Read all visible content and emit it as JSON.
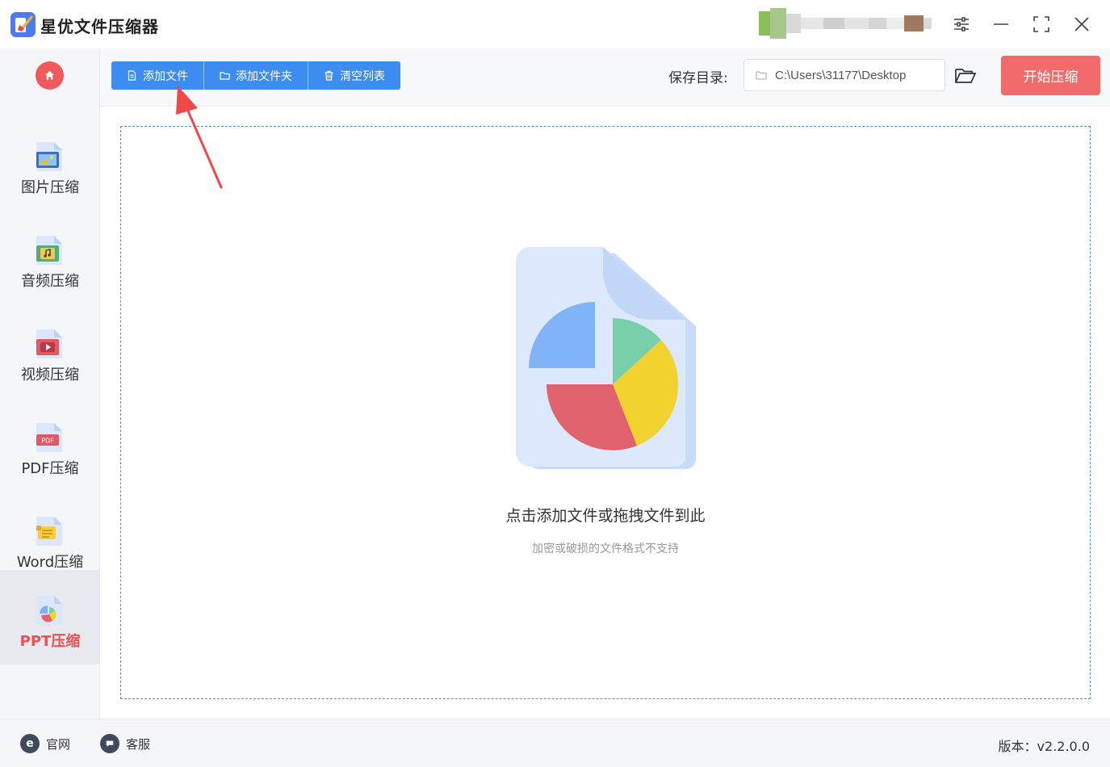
{
  "app": {
    "title": "星优文件压缩器"
  },
  "window_controls": {
    "icons": [
      "sliders-icon",
      "minimize-icon",
      "maximize-icon",
      "close-icon"
    ]
  },
  "sidebar": {
    "items": [
      {
        "label": "图片压缩",
        "icon": "image-file-icon"
      },
      {
        "label": "音频压缩",
        "icon": "audio-file-icon"
      },
      {
        "label": "视频压缩",
        "icon": "video-file-icon"
      },
      {
        "label": "PDF压缩",
        "icon": "pdf-file-icon"
      },
      {
        "label": "Word压缩",
        "icon": "word-file-icon"
      },
      {
        "label": "PPT压缩",
        "icon": "ppt-file-icon"
      }
    ],
    "active_index": 5,
    "accent_color": "#ee5050"
  },
  "toolbar": {
    "add_file_label": "添加文件",
    "add_folder_label": "添加文件夹",
    "clear_list_label": "清空列表",
    "save_dir_label": "保存目录:",
    "save_dir_value": "C:\\Users\\31177\\Desktop",
    "start_label": "开始压缩",
    "button_color": "#3d8df0",
    "start_color": "#f26b6b"
  },
  "dropzone": {
    "title": "点击添加文件或拖拽文件到此",
    "subtitle": "加密或破损的文件格式不支持"
  },
  "footer": {
    "website_label": "官网",
    "support_label": "客服",
    "version_label": "版本：v2.2.0.0"
  }
}
